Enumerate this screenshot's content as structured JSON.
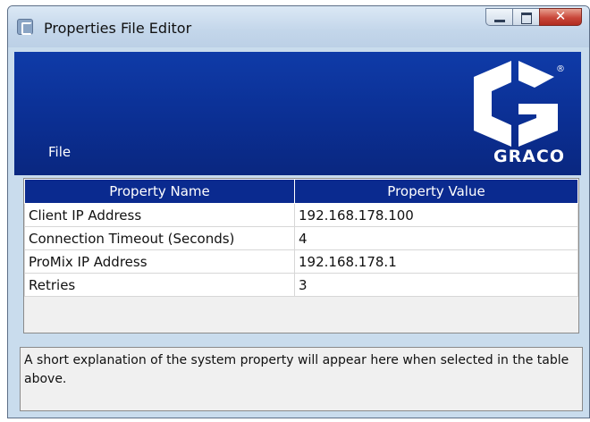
{
  "window": {
    "title": "Properties File Editor"
  },
  "menu": {
    "file_label": "File"
  },
  "logo": {
    "text": "GRACO",
    "registered_mark": "®"
  },
  "table": {
    "headers": [
      "Property Name",
      "Property Value"
    ],
    "rows": [
      {
        "name": "Client IP Address",
        "value": "192.168.178.100"
      },
      {
        "name": "Connection Timeout (Seconds)",
        "value": "4"
      },
      {
        "name": "ProMix IP Address",
        "value": "192.168.178.1"
      },
      {
        "name": "Retries",
        "value": "3"
      }
    ]
  },
  "description": {
    "text": "A short explanation of the system property will appear here when selected in the table above."
  },
  "colors": {
    "banner": "#0b2f93",
    "header": "#0a2a8f",
    "close_button": "#c9473a"
  },
  "icons": [
    "app-icon",
    "minimize-icon",
    "maximize-icon",
    "close-icon",
    "graco-logo"
  ]
}
